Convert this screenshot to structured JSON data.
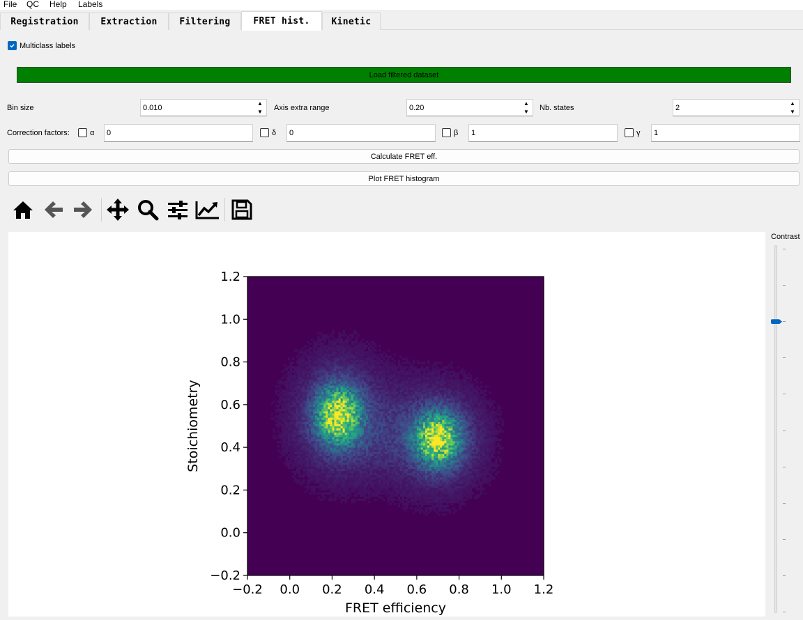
{
  "menu": [
    "File",
    "QC",
    "Help",
    "Labels"
  ],
  "tabs": [
    {
      "label": "Registration",
      "active": false
    },
    {
      "label": "Extraction",
      "active": false
    },
    {
      "label": "Filtering",
      "active": false
    },
    {
      "label": "FRET hist.",
      "active": true
    },
    {
      "label": "Kinetic",
      "active": false
    }
  ],
  "multiclass": {
    "label": "Multiclass labels",
    "checked": true
  },
  "load_button": {
    "label": "Load filtered dataset",
    "color": "#008000"
  },
  "params": {
    "bin_size": {
      "label": "Bin size",
      "value": "0.010"
    },
    "axis_extra_range": {
      "label": "Axis extra range",
      "value": "0.20"
    },
    "nb_states": {
      "label": "Nb. states",
      "value": "2"
    }
  },
  "corrections": {
    "label": "Correction factors:",
    "items": [
      {
        "symbol": "α",
        "checked": false,
        "value": "0"
      },
      {
        "symbol": "δ",
        "checked": false,
        "value": "0"
      },
      {
        "symbol": "β",
        "checked": false,
        "value": "1"
      },
      {
        "symbol": "γ",
        "checked": false,
        "value": "1"
      }
    ]
  },
  "buttons": {
    "calculate": "Calculate FRET eff.",
    "plot": "Plot FRET histogram"
  },
  "toolbar_icons": [
    "home-icon",
    "back-arrow-icon",
    "forward-arrow-icon",
    "pan-icon",
    "zoom-icon",
    "configure-subplots-icon",
    "edit-axis-icon",
    "save-icon"
  ],
  "contrast": {
    "label": "Contrast",
    "level": 0.2
  },
  "chart_data": {
    "type": "heatmap",
    "title": "",
    "xlabel": "FRET efficiency",
    "ylabel": "Stoichiometry",
    "xlim": [
      -0.2,
      1.2
    ],
    "ylim": [
      -0.2,
      1.2
    ],
    "xticks": [
      "−0.2",
      "0.0",
      "0.2",
      "0.4",
      "0.6",
      "0.8",
      "1.0",
      "1.2"
    ],
    "yticks": [
      "−0.2",
      "0.0",
      "0.2",
      "0.4",
      "0.6",
      "0.8",
      "1.0",
      "1.2"
    ],
    "bin_size": 0.01,
    "colormap": "viridis",
    "clusters": [
      {
        "x": 0.23,
        "y": 0.55,
        "sx": 0.07,
        "sy": 0.09
      },
      {
        "x": 0.7,
        "y": 0.44,
        "sx": 0.07,
        "sy": 0.08
      }
    ]
  }
}
